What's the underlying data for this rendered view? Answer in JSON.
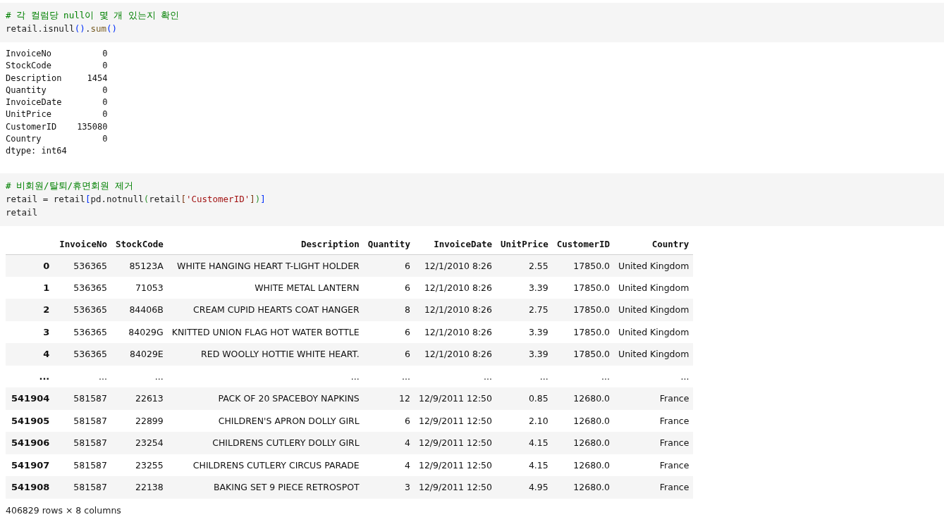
{
  "cells": [
    {
      "kind": "code",
      "lines": [
        [
          {
            "kind": "comment",
            "text": "# 각 컬럼당 null이 몇 개 있는지 확인"
          }
        ],
        [
          {
            "kind": "plain",
            "text": "retail.isnull"
          },
          {
            "kind": "bracket-1",
            "text": "()"
          },
          {
            "kind": "plain",
            "text": "."
          },
          {
            "kind": "function",
            "text": "sum"
          },
          {
            "kind": "bracket-1",
            "text": "()"
          }
        ]
      ]
    },
    {
      "kind": "text",
      "lines": [
        "InvoiceNo          0",
        "StockCode          0",
        "Description     1454",
        "Quantity           0",
        "InvoiceDate        0",
        "UnitPrice          0",
        "CustomerID    135080",
        "Country            0",
        "dtype: int64"
      ]
    },
    {
      "kind": "code",
      "lines": [
        [
          {
            "kind": "comment",
            "text": "# 비회원/탈퇴/휴면회원 제거"
          }
        ],
        [
          {
            "kind": "plain",
            "text": "retail = retail"
          },
          {
            "kind": "bracket-1",
            "text": "["
          },
          {
            "kind": "plain",
            "text": "pd.notnull"
          },
          {
            "kind": "bracket-2",
            "text": "("
          },
          {
            "kind": "plain",
            "text": "retail"
          },
          {
            "kind": "bracket-3",
            "text": "["
          },
          {
            "kind": "string",
            "text": "'CustomerID'"
          },
          {
            "kind": "bracket-3",
            "text": "]"
          },
          {
            "kind": "bracket-2",
            "text": ")"
          },
          {
            "kind": "bracket-1",
            "text": "]"
          }
        ],
        [
          {
            "kind": "plain",
            "text": "retail"
          }
        ]
      ]
    },
    {
      "kind": "dataframe",
      "columns": [
        "InvoiceNo",
        "StockCode",
        "Description",
        "Quantity",
        "InvoiceDate",
        "UnitPrice",
        "CustomerID",
        "Country"
      ],
      "rows": [
        {
          "index": "0",
          "cells": [
            "536365",
            "85123A",
            "WHITE HANGING HEART T-LIGHT HOLDER",
            "6",
            "12/1/2010 8:26",
            "2.55",
            "17850.0",
            "United Kingdom"
          ]
        },
        {
          "index": "1",
          "cells": [
            "536365",
            "71053",
            "WHITE METAL LANTERN",
            "6",
            "12/1/2010 8:26",
            "3.39",
            "17850.0",
            "United Kingdom"
          ]
        },
        {
          "index": "2",
          "cells": [
            "536365",
            "84406B",
            "CREAM CUPID HEARTS COAT HANGER",
            "8",
            "12/1/2010 8:26",
            "2.75",
            "17850.0",
            "United Kingdom"
          ]
        },
        {
          "index": "3",
          "cells": [
            "536365",
            "84029G",
            "KNITTED UNION FLAG HOT WATER BOTTLE",
            "6",
            "12/1/2010 8:26",
            "3.39",
            "17850.0",
            "United Kingdom"
          ]
        },
        {
          "index": "4",
          "cells": [
            "536365",
            "84029E",
            "RED WOOLLY HOTTIE WHITE HEART.",
            "6",
            "12/1/2010 8:26",
            "3.39",
            "17850.0",
            "United Kingdom"
          ]
        },
        {
          "index": "...",
          "cells": [
            "...",
            "...",
            "...",
            "...",
            "...",
            "...",
            "...",
            "..."
          ]
        },
        {
          "index": "541904",
          "cells": [
            "581587",
            "22613",
            "PACK OF 20 SPACEBOY NAPKINS",
            "12",
            "12/9/2011 12:50",
            "0.85",
            "12680.0",
            "France"
          ]
        },
        {
          "index": "541905",
          "cells": [
            "581587",
            "22899",
            "CHILDREN'S APRON DOLLY GIRL",
            "6",
            "12/9/2011 12:50",
            "2.10",
            "12680.0",
            "France"
          ]
        },
        {
          "index": "541906",
          "cells": [
            "581587",
            "23254",
            "CHILDRENS CUTLERY DOLLY GIRL",
            "4",
            "12/9/2011 12:50",
            "4.15",
            "12680.0",
            "France"
          ]
        },
        {
          "index": "541907",
          "cells": [
            "581587",
            "23255",
            "CHILDRENS CUTLERY CIRCUS PARADE",
            "4",
            "12/9/2011 12:50",
            "4.15",
            "12680.0",
            "France"
          ]
        },
        {
          "index": "541908",
          "cells": [
            "581587",
            "22138",
            "BAKING SET 9 PIECE RETROSPOT",
            "3",
            "12/9/2011 12:50",
            "4.95",
            "12680.0",
            "France"
          ]
        }
      ],
      "footer": "406829 rows × 8 columns"
    }
  ]
}
